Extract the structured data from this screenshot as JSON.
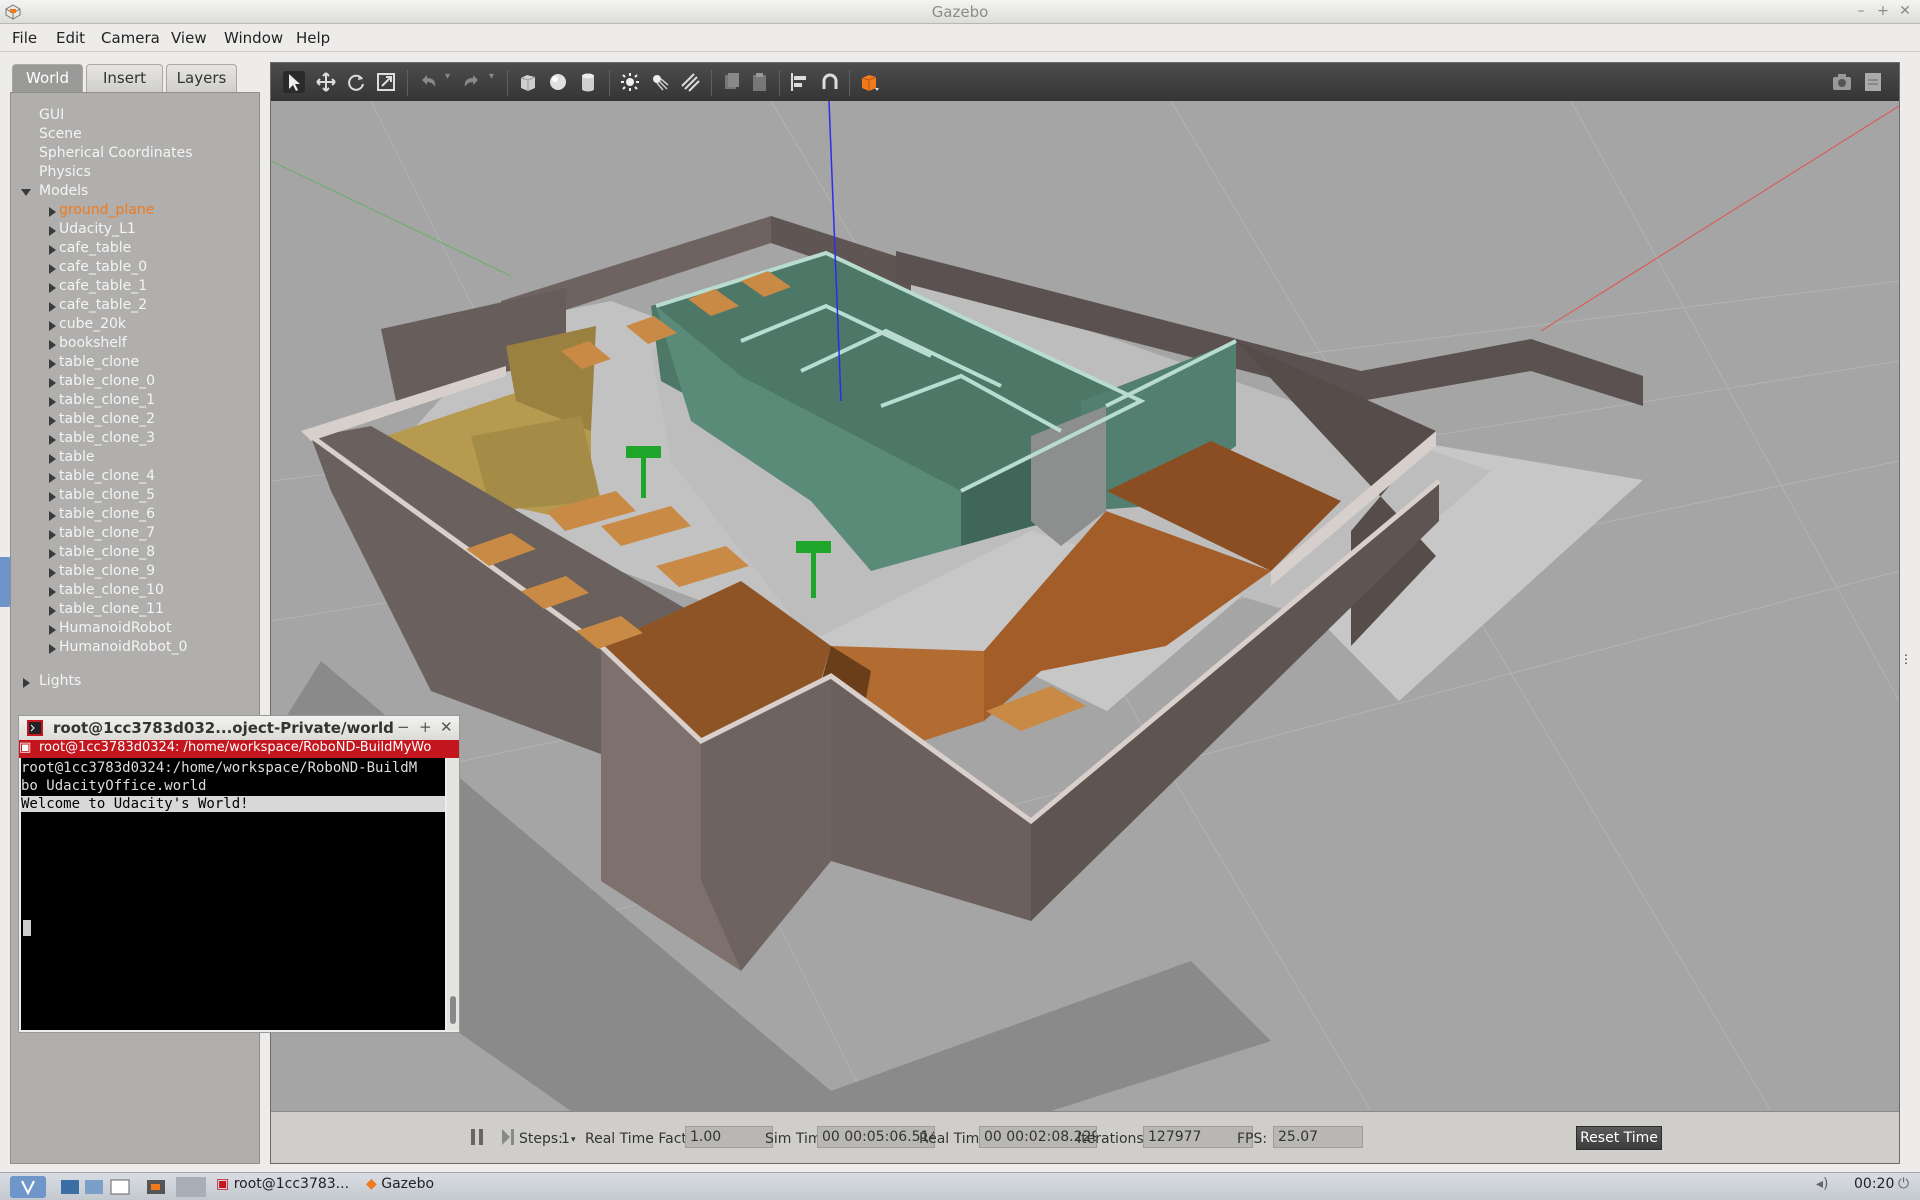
{
  "window": {
    "title": "Gazebo"
  },
  "menu": [
    "File",
    "Edit",
    "Camera",
    "View",
    "Window",
    "Help"
  ],
  "tabs": [
    "World",
    "Insert",
    "Layers"
  ],
  "tree": {
    "top": [
      "GUI",
      "Scene",
      "Spherical Coordinates",
      "Physics"
    ],
    "models_label": "Models",
    "models": [
      "ground_plane",
      "Udacity_L1",
      "cafe_table",
      "cafe_table_0",
      "cafe_table_1",
      "cafe_table_2",
      "cube_20k",
      "bookshelf",
      "table_clone",
      "table_clone_0",
      "table_clone_1",
      "table_clone_2",
      "table_clone_3",
      "table",
      "table_clone_4",
      "table_clone_5",
      "table_clone_6",
      "table_clone_7",
      "table_clone_8",
      "table_clone_9",
      "table_clone_10",
      "table_clone_11",
      "HumanoidRobot",
      "HumanoidRobot_0"
    ],
    "selected": "ground_plane",
    "lights_label": "Lights"
  },
  "toolbar_icons": [
    "select-arrow-icon",
    "translate-icon",
    "rotate-icon",
    "scale-icon",
    "undo-icon",
    "redo-icon",
    "box-icon",
    "sphere-icon",
    "cylinder-icon",
    "point-light-icon",
    "spot-light-icon",
    "directional-light-icon",
    "copy-icon",
    "paste-icon",
    "align-icon",
    "snap-icon",
    "view-angle-icon",
    "screenshot-icon",
    "log-icon"
  ],
  "stats": {
    "steps_label": "Steps:",
    "steps_value": "1",
    "rtf_label": "Real Time Factor:",
    "rtf_value": "1.00",
    "sim_label": "Sim Time:",
    "sim_value": "00 00:05:06.514",
    "real_label": "Real Time:",
    "real_value": "00 00:02:08.229",
    "iter_label": "Iterations:",
    "iter_value": "127977",
    "fps_label": "FPS:",
    "fps_value": "25.07",
    "reset_label": "Reset Time"
  },
  "terminal": {
    "window_title": "root@1cc3783d032...oject-Private/world",
    "tab_title": "root@1cc3783d0324: /home/workspace/RoboND-BuildMyWo",
    "lines": [
      "root@1cc3783d0324:/home/workspace/RoboND-BuildM",
      "bo UdacityOffice.world",
      "Welcome to Udacity's World!"
    ]
  },
  "taskbar": {
    "items": [
      "root@1cc3783...",
      "Gazebo"
    ],
    "clock": "00:20"
  },
  "colors": {
    "selected_text": "#f07a1c",
    "terminal_tab": "#c4161e",
    "scene_bg": "#a6a6a6"
  }
}
